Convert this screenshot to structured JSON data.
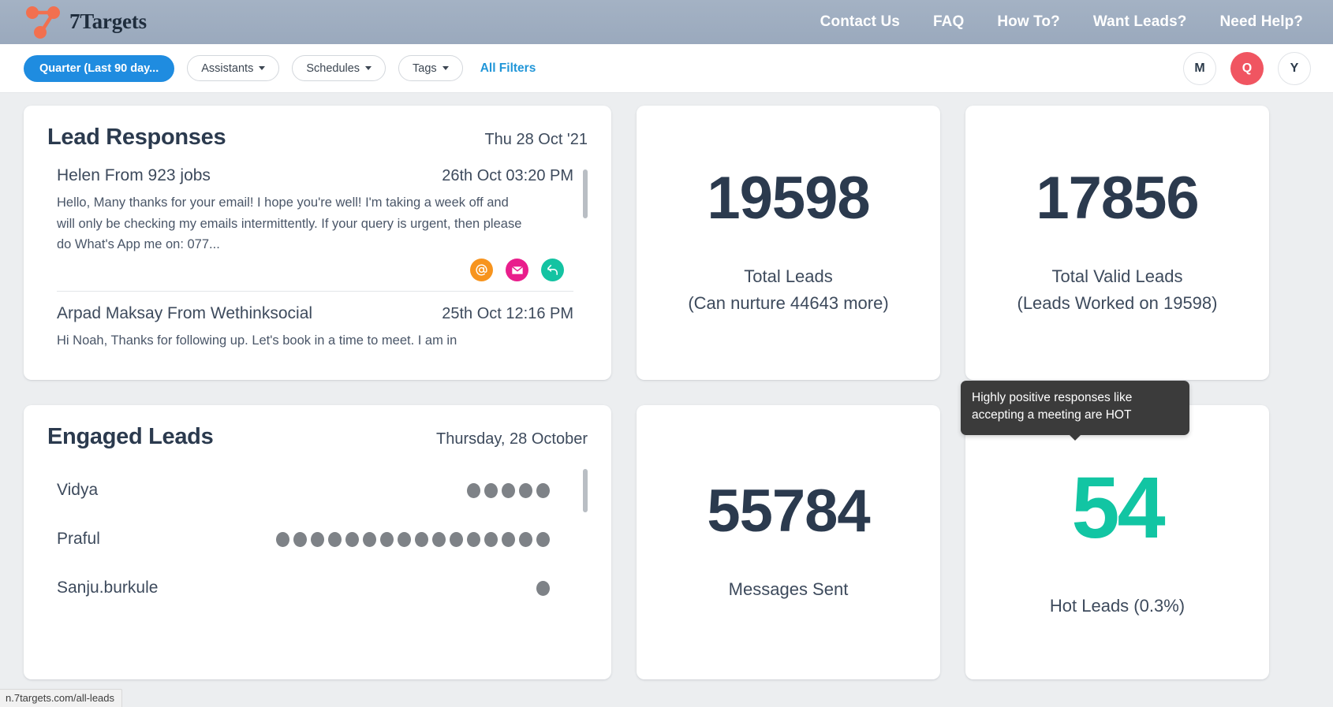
{
  "topnav": {
    "brand": "7Targets",
    "logo_icon": "seven-targets-network-logo",
    "links": [
      {
        "label": "Contact Us"
      },
      {
        "label": "FAQ"
      },
      {
        "label": "How To?"
      },
      {
        "label": "Want Leads?"
      },
      {
        "label": "Need Help?"
      }
    ]
  },
  "filterbar": {
    "date_filter": "Quarter (Last 90 day...",
    "assistants": "Assistants",
    "schedules": "Schedules",
    "tags": "Tags",
    "all_filters": "All Filters",
    "avatars": [
      {
        "initial": "M",
        "style": "outline"
      },
      {
        "initial": "Q",
        "style": "filled",
        "color": "#f05561"
      },
      {
        "initial": "Y",
        "style": "outline"
      }
    ]
  },
  "lead_responses": {
    "title": "Lead Responses",
    "date": "Thu 28 Oct '21",
    "items": [
      {
        "name": "Helen From 923 jobs",
        "time": "26th Oct 03:20 PM",
        "snippet": "Hello, Many thanks for your email! I hope you're well! I'm taking a week off and will only be checking my emails intermittently. If your query is urgent, then please do What's App me on: 077...",
        "actions": [
          {
            "icon": "at-sign-icon",
            "color": "#f7941e"
          },
          {
            "icon": "envelope-icon",
            "color": "#e91e8c"
          },
          {
            "icon": "reply-arrow-icon",
            "color": "#14c3a2"
          }
        ]
      },
      {
        "name": "Arpad Maksay From Wethinksocial",
        "time": "25th Oct 12:16 PM",
        "snippet": "Hi Noah, Thanks for following up. Let's book in a time to meet. I am in"
      }
    ]
  },
  "engaged_leads": {
    "title": "Engaged Leads",
    "date": "Thursday, 28 October",
    "items": [
      {
        "name": "Vidya",
        "dots": 5
      },
      {
        "name": "Praful",
        "dots": 16
      },
      {
        "name": "Sanju.burkule",
        "dots": 1
      }
    ]
  },
  "stats": [
    {
      "value": "19598",
      "label": "Total Leads",
      "sub": "(Can nurture 44643 more)",
      "accent": false
    },
    {
      "value": "17856",
      "label": "Total Valid Leads",
      "sub": "(Leads Worked on 19598)",
      "accent": false
    },
    {
      "value": "55784",
      "label": "Messages Sent",
      "sub": "",
      "accent": false
    },
    {
      "value": "54",
      "label": "Hot Leads (0.3%)",
      "sub": "",
      "accent": true,
      "accent_color": "#12c5a3"
    }
  ],
  "tooltip": {
    "text": "Highly positive responses like accepting a meeting are HOT"
  },
  "statusbar": {
    "url": "n.7targets.com/all-leads"
  }
}
